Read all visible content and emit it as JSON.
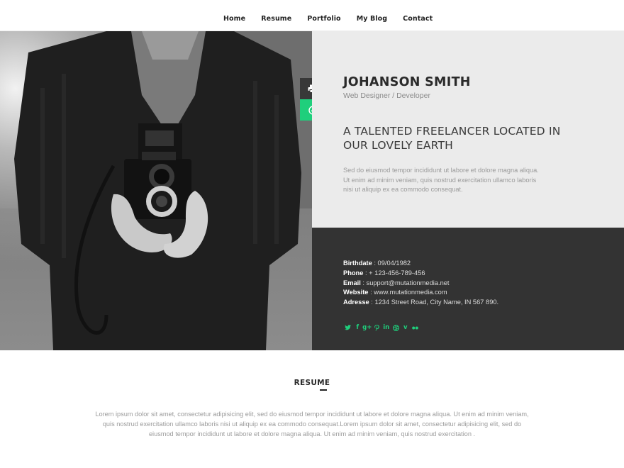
{
  "nav": {
    "items": [
      {
        "label": "Home"
      },
      {
        "label": "Resume"
      },
      {
        "label": "Portfolio"
      },
      {
        "label": "My Blog"
      },
      {
        "label": "Contact"
      }
    ]
  },
  "hero": {
    "photo_icon": "camera-photo",
    "actions": [
      {
        "icon": "print-icon"
      },
      {
        "icon": "download-icon"
      }
    ]
  },
  "profile": {
    "name": "JOHANSON SMITH",
    "role": "Web Designer / Developer",
    "tagline": "A TALENTED FREELANCER LOCATED IN OUR LOVELY EARTH",
    "description": "Sed do eiusmod tempor incididunt ut labore et dolore magna aliqua. Ut enim ad minim veniam, quis nostrud exercitation ullamco laboris nisi ut aliquip ex ea commodo consequat."
  },
  "details": [
    {
      "label": "Birthdate",
      "value": " : 09/04/1982"
    },
    {
      "label": "Phone",
      "value": " : + 123-456-789-456"
    },
    {
      "label": "Email",
      "value": " : support@mutationmedia.net"
    },
    {
      "label": "Website",
      "value": " : www.mutationmedia.com"
    },
    {
      "label": "Adresse",
      "value": " : 1234 Street Road, City Name, IN 567 890."
    }
  ],
  "socials": [
    "twitter-icon",
    "facebook-icon",
    "google-plus-icon",
    "pinterest-icon",
    "linkedin-icon",
    "dribbble-icon",
    "vimeo-icon",
    "flickr-icon"
  ],
  "colors": {
    "accent": "#1fcf7c",
    "dark_panel": "#333333",
    "light_panel": "#ebebeb"
  },
  "resume": {
    "title": "RESUME",
    "text": "Lorem ipsum dolor sit amet, consectetur adipisicing elit, sed do eiusmod tempor incididunt ut labore et dolore magna aliqua. Ut enim ad minim veniam, quis nostrud exercitation ullamco laboris nisi ut aliquip ex ea commodo consequat.Lorem ipsum dolor sit amet, consectetur adipisicing elit, sed do eiusmod tempor incididunt ut labore et dolore magna aliqua. Ut enim ad minim veniam, quis nostrud exercitation ."
  }
}
